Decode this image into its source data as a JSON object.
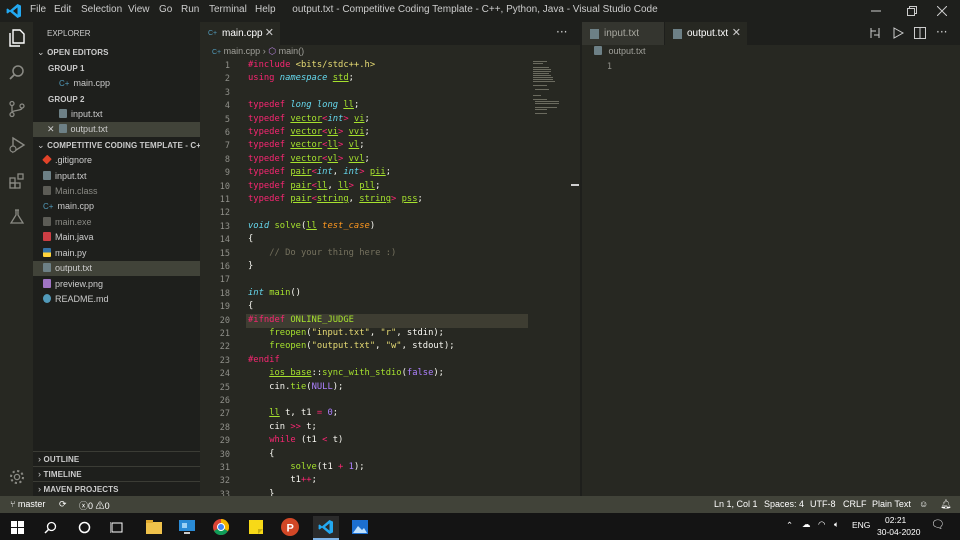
{
  "titlebar": {
    "menus": [
      "File",
      "Edit",
      "Selection",
      "View",
      "Go",
      "Run",
      "Terminal",
      "Help"
    ],
    "title": "output.txt - Competitive Coding Template - C++, Python, Java - Visual Studio Code"
  },
  "sidebar": {
    "explorer": "EXPLORER",
    "open_editors": "OPEN EDITORS",
    "group1": "GROUP 1",
    "group1_file": "main.cpp",
    "group2": "GROUP 2",
    "group2_files": [
      "input.txt",
      "output.txt"
    ],
    "project": "COMPETITIVE CODING TEMPLATE - C+...",
    "files": [
      ".gitignore",
      "input.txt",
      "Main.class",
      "main.cpp",
      "main.exe",
      "Main.java",
      "main.py",
      "output.txt",
      "preview.png",
      "README.md"
    ],
    "outline": "OUTLINE",
    "timeline": "TIMELINE",
    "maven": "MAVEN PROJECTS"
  },
  "tabs_left": {
    "active": "main.cpp"
  },
  "breadcrumb": {
    "file": "main.cpp",
    "symbol": "main()"
  },
  "tabs_right": {
    "inactive": "input.txt",
    "active": "output.txt"
  },
  "right_breadcrumb": "output.txt",
  "code": {
    "lines": [
      [
        [
          "k",
          "#include "
        ],
        [
          "s",
          "<bits/stdc++.h>"
        ]
      ],
      [
        [
          "k",
          "using "
        ],
        [
          "it",
          "namespace "
        ],
        [
          "ty",
          "std"
        ],
        [
          "",
          "; "
        ]
      ],
      [],
      [
        [
          "k",
          "typedef "
        ],
        [
          "t",
          "long long "
        ],
        [
          "ty",
          "ll"
        ],
        [
          "",
          ";"
        ]
      ],
      [
        [
          "k",
          "typedef "
        ],
        [
          "ty",
          "vector"
        ],
        [
          "k",
          "<"
        ],
        [
          "t",
          "int"
        ],
        [
          "k",
          "> "
        ],
        [
          "ty",
          "vi"
        ],
        [
          "",
          ";"
        ]
      ],
      [
        [
          "k",
          "typedef "
        ],
        [
          "ty",
          "vector"
        ],
        [
          "k",
          "<"
        ],
        [
          "ty",
          "vi"
        ],
        [
          "k",
          "> "
        ],
        [
          "ty",
          "vvi"
        ],
        [
          "",
          ";"
        ]
      ],
      [
        [
          "k",
          "typedef "
        ],
        [
          "ty",
          "vector"
        ],
        [
          "k",
          "<"
        ],
        [
          "ty",
          "ll"
        ],
        [
          "k",
          "> "
        ],
        [
          "ty",
          "vl"
        ],
        [
          "",
          ";"
        ]
      ],
      [
        [
          "k",
          "typedef "
        ],
        [
          "ty",
          "vector"
        ],
        [
          "k",
          "<"
        ],
        [
          "ty",
          "vl"
        ],
        [
          "k",
          "> "
        ],
        [
          "ty",
          "vvl"
        ],
        [
          "",
          ";"
        ]
      ],
      [
        [
          "k",
          "typedef "
        ],
        [
          "ty",
          "pair"
        ],
        [
          "k",
          "<"
        ],
        [
          "t",
          "int"
        ],
        [
          "",
          ", "
        ],
        [
          "t",
          "int"
        ],
        [
          "k",
          "> "
        ],
        [
          "ty",
          "pii"
        ],
        [
          "",
          ";"
        ]
      ],
      [
        [
          "k",
          "typedef "
        ],
        [
          "ty",
          "pair"
        ],
        [
          "k",
          "<"
        ],
        [
          "ty",
          "ll"
        ],
        [
          "",
          ", "
        ],
        [
          "ty",
          "ll"
        ],
        [
          "k",
          "> "
        ],
        [
          "ty",
          "pll"
        ],
        [
          "",
          ";"
        ]
      ],
      [
        [
          "k",
          "typedef "
        ],
        [
          "ty",
          "pair"
        ],
        [
          "k",
          "<"
        ],
        [
          "ty",
          "string"
        ],
        [
          "",
          ", "
        ],
        [
          "ty",
          "string"
        ],
        [
          "k",
          "> "
        ],
        [
          "ty",
          "pss"
        ],
        [
          "",
          ";"
        ]
      ],
      [],
      [
        [
          "t",
          "void "
        ],
        [
          "n",
          "solve"
        ],
        [
          "",
          "("
        ],
        [
          "ty",
          "ll"
        ],
        [
          "",
          " "
        ],
        [
          "p",
          "test_case"
        ],
        [
          "",
          ")"
        ]
      ],
      [
        [
          "",
          "{"
        ]
      ],
      [
        [
          "",
          "    "
        ],
        [
          "c",
          "// Do your thing here :)"
        ]
      ],
      [
        [
          "",
          "}"
        ]
      ],
      [],
      [
        [
          "t",
          "int "
        ],
        [
          "n",
          "main"
        ],
        [
          "",
          "()"
        ]
      ],
      [
        [
          "",
          "{"
        ]
      ],
      [
        [
          "k",
          "#ifndef "
        ],
        [
          "n",
          "ONLINE_JUDGE"
        ]
      ],
      [
        [
          "",
          "    "
        ],
        [
          "n",
          "freopen"
        ],
        [
          "",
          "("
        ],
        [
          "s",
          "\"input.txt\""
        ],
        [
          "",
          ", "
        ],
        [
          "s",
          "\"r\""
        ],
        [
          "",
          ", stdin);"
        ]
      ],
      [
        [
          "",
          "    "
        ],
        [
          "n",
          "freopen"
        ],
        [
          "",
          "("
        ],
        [
          "s",
          "\"output.txt\""
        ],
        [
          "",
          ", "
        ],
        [
          "s",
          "\"w\""
        ],
        [
          "",
          ", stdout);"
        ]
      ],
      [
        [
          "k",
          "#endif"
        ]
      ],
      [
        [
          "",
          "    "
        ],
        [
          "ty",
          "ios_base"
        ],
        [
          "",
          "::"
        ],
        [
          "n",
          "sync_with_stdio"
        ],
        [
          "",
          "("
        ],
        [
          "num",
          "false"
        ],
        [
          "",
          ");"
        ]
      ],
      [
        [
          "",
          "    cin."
        ],
        [
          "n",
          "tie"
        ],
        [
          "",
          "("
        ],
        [
          "num",
          "NULL"
        ],
        [
          "",
          ");"
        ]
      ],
      [],
      [
        [
          "",
          "    "
        ],
        [
          "ty",
          "ll"
        ],
        [
          "",
          " t, t1 "
        ],
        [
          "k",
          "="
        ],
        [
          "",
          " "
        ],
        [
          "num",
          "0"
        ],
        [
          "",
          ";"
        ]
      ],
      [
        [
          "",
          "    cin "
        ],
        [
          "k",
          ">>"
        ],
        [
          "",
          " t;"
        ]
      ],
      [
        [
          "",
          "    "
        ],
        [
          "k",
          "while"
        ],
        [
          "",
          " (t1 "
        ],
        [
          "k",
          "<"
        ],
        [
          "",
          " t)"
        ]
      ],
      [
        [
          "",
          "    {"
        ]
      ],
      [
        [
          "",
          "        "
        ],
        [
          "n",
          "solve"
        ],
        [
          "",
          "(t1 "
        ],
        [
          "k",
          "+"
        ],
        [
          "",
          " "
        ],
        [
          "num",
          "1"
        ],
        [
          "",
          ");"
        ]
      ],
      [
        [
          "",
          "        t1"
        ],
        [
          "k",
          "++"
        ],
        [
          "",
          ";"
        ]
      ],
      [
        [
          "",
          "    }"
        ]
      ]
    ]
  },
  "right_line": "1",
  "status": {
    "branch": "master",
    "errors": "0",
    "warnings": "0",
    "position": "Ln 1, Col 1",
    "spaces": "Spaces: 4",
    "encoding": "UTF-8",
    "eol": "CRLF",
    "language": "Plain Text"
  },
  "taskbar": {
    "lang": "ENG",
    "time": "02:21",
    "date": "30-04-2020"
  }
}
